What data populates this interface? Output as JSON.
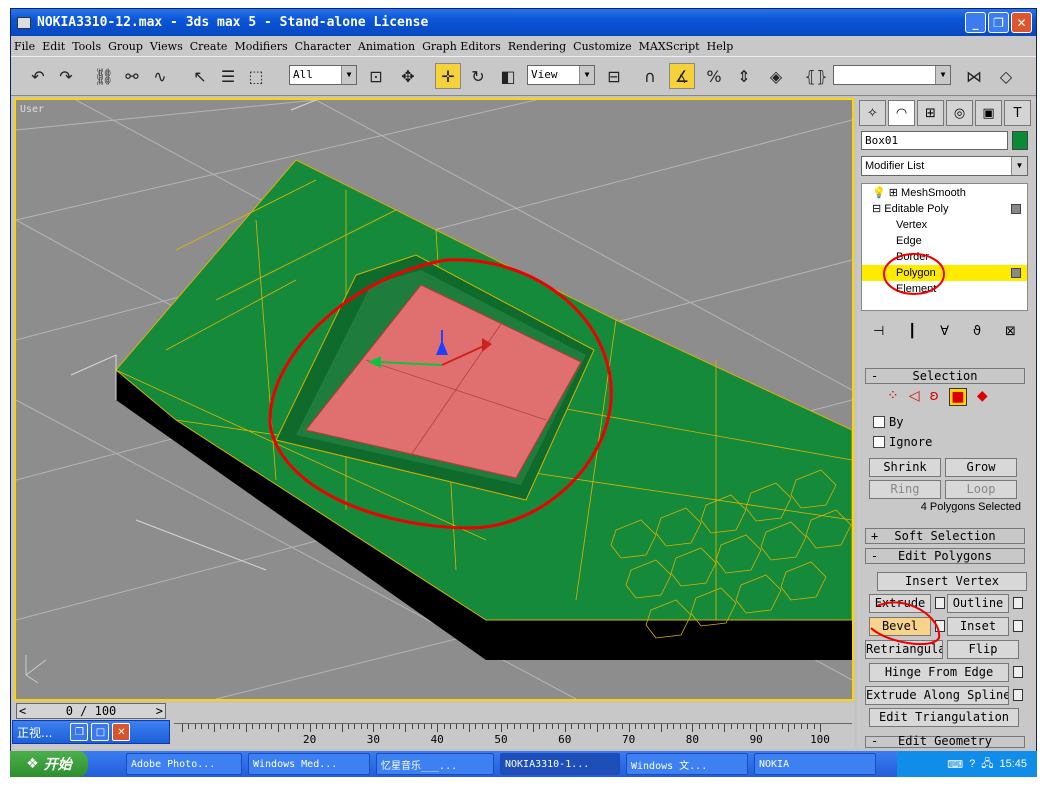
{
  "title": "NOKIA3310-12.max - 3ds max 5 - Stand-alone License",
  "menu": [
    "File",
    "Edit",
    "Tools",
    "Group",
    "Views",
    "Create",
    "Modifiers",
    "Character",
    "Animation",
    "Graph Editors",
    "Rendering",
    "Customize",
    "MAXScript",
    "Help"
  ],
  "toolbar": {
    "selection_filter": "All",
    "coord_system": "View"
  },
  "viewport": {
    "label": "User"
  },
  "panel": {
    "object_name": "Box01",
    "object_color": "#0a8a34",
    "modifier_list": "Modifier List",
    "stack": [
      {
        "label": "MeshSmooth",
        "level": 0
      },
      {
        "label": "Editable Poly",
        "level": 0
      },
      {
        "label": "Vertex",
        "level": 1
      },
      {
        "label": "Edge",
        "level": 1
      },
      {
        "label": "Border",
        "level": 1
      },
      {
        "label": "Polygon",
        "level": 1,
        "selected": true
      },
      {
        "label": "Element",
        "level": 1
      }
    ],
    "selection": {
      "rollout": "Selection",
      "by_label": "By",
      "ignore_label": "Ignore",
      "shrink": "Shrink",
      "grow": "Grow",
      "ring": "Ring",
      "loop": "Loop",
      "status": "4 Polygons Selected"
    },
    "soft_selection": "Soft Selection",
    "edit_polygons": {
      "rollout": "Edit Polygons",
      "insert_vertex": "Insert Vertex",
      "extrude": "Extrude",
      "outline": "Outline",
      "bevel": "Bevel",
      "inset": "Inset",
      "retriangulate": "Retriangulate",
      "flip": "Flip",
      "hinge": "Hinge From Edge",
      "extrude_spline": "Extrude Along Spline",
      "edit_tri": "Edit Triangulation"
    },
    "edit_geometry": "Edit Geometry"
  },
  "timeline": {
    "position": "0 / 100",
    "ticks": [
      "20",
      "30",
      "40",
      "50",
      "60",
      "70",
      "80",
      "90",
      "100"
    ]
  },
  "minimized_window": {
    "title": "正视..."
  },
  "taskbar": {
    "start": "开始",
    "items": [
      "Adobe Photo...",
      "Windows Med...",
      "忆星音乐___...",
      "NOKIA3310-1...",
      "Windows 文...",
      "NOKIA"
    ],
    "clock": "15:45"
  }
}
